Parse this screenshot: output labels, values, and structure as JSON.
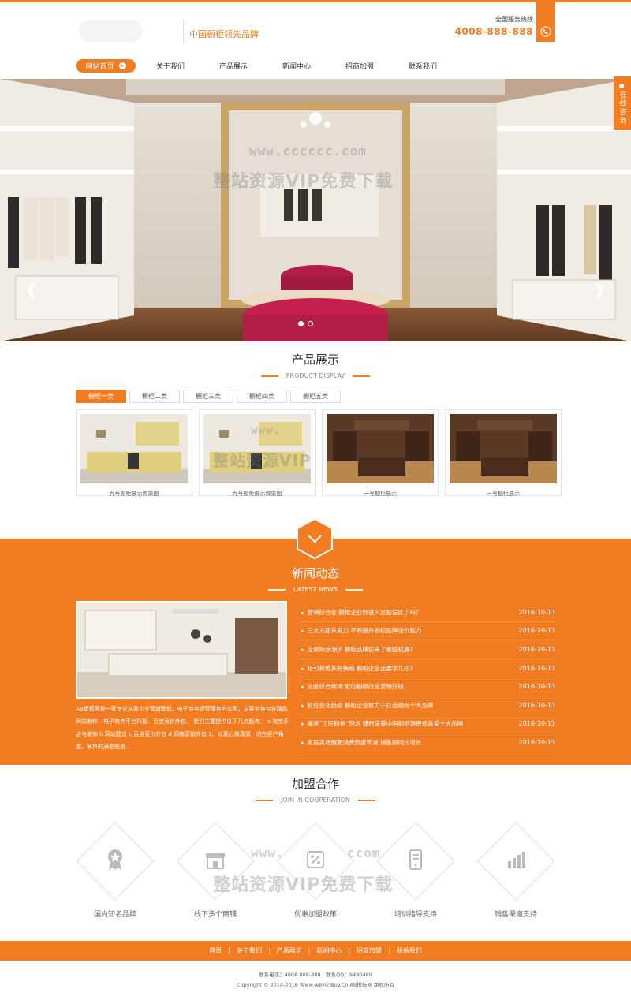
{
  "header": {
    "slogan": "中国橱柜领先品牌",
    "hotline_label": "全国服务热线",
    "hotline_number": "4008-888-888",
    "phone_icon": "phone-icon"
  },
  "nav": {
    "items": [
      {
        "label": "网站首页",
        "active": true
      },
      {
        "label": "关于我们"
      },
      {
        "label": "产品展示"
      },
      {
        "label": "新闻中心"
      },
      {
        "label": "招商加盟"
      },
      {
        "label": "联系我们"
      }
    ]
  },
  "banner": {
    "consult_label": "在线咨询",
    "prev_icon": "chevron-left-icon",
    "next_icon": "chevron-right-icon",
    "slides_total": 2,
    "slide_active": 1
  },
  "watermark": {
    "url": "www.cccccc.com",
    "text": "整站资源VIP免费下载",
    "url_partial": "www.",
    "text_partial": "整站资源VIP",
    "url_bottom": "www.",
    "url_bottom_end": "ccom"
  },
  "products": {
    "title": "产品展示",
    "subtitle": "PRODUCT DISPLAY",
    "tabs": [
      "橱柜一类",
      "橱柜二类",
      "橱柜三类",
      "橱柜四类",
      "橱柜五类"
    ],
    "items": [
      {
        "caption": "九号橱柜展示效果图",
        "style": "light"
      },
      {
        "caption": "九号橱柜展示效果图",
        "style": "light"
      },
      {
        "caption": "一号橱柜展示",
        "style": "dark"
      },
      {
        "caption": "一号橱柜展示",
        "style": "dark"
      }
    ]
  },
  "news": {
    "title": "新闻动态",
    "subtitle": "LATEST NEWS",
    "description": "AB模板网是一家专业从事企业营销策划、电子商务运营服务的公司，主要业务包含精品网站制作、电子商务平台托管、百度竞价外包、 我们主要提供以下几点服务： a 淘宝开店与装修 b 网站建设 c 百度竞价外包 d 网络营销外包 1、以真心换真情，站在客户角度，客户的满意就是...",
    "items": [
      {
        "title": "营销综合症 橱柜企业你进入这些误区了吗？",
        "date": "2016-10-13"
      },
      {
        "title": "三大方面来发力 不断提升橱柜品牌溢价能力",
        "date": "2016-10-13"
      },
      {
        "title": "互联网浪潮下 橱柜品牌迎来了哪些机遇?",
        "date": "2016-10-13"
      },
      {
        "title": "吸引和维系经销商 橱柜企业还要学几招?",
        "date": "2016-10-13"
      },
      {
        "title": "进驻综合商场 驱动橱柜行业营销升级",
        "date": "2016-10-13"
      },
      {
        "title": "抓住变化趋势 橱柜企业致力于打造橱柜十大品牌",
        "date": "2016-10-13"
      },
      {
        "title": "秉承“工匠精神”理念 捷西荣获中国橱柜消费者喜爱十大品牌",
        "date": "2016-10-13"
      },
      {
        "title": "家居卖场假期消费热度不减 销售额同比增长",
        "date": "2016-10-13"
      }
    ]
  },
  "cooperation": {
    "title": "加盟合作",
    "subtitle": "JOIN IN COOPERATION",
    "items": [
      {
        "label": "国内知名品牌",
        "icon": "award-icon"
      },
      {
        "label": "线下多个商铺",
        "icon": "store-icon"
      },
      {
        "label": "优惠加盟政策",
        "icon": "discount-icon"
      },
      {
        "label": "培训指导支持",
        "icon": "training-icon"
      },
      {
        "label": "销售渠道支持",
        "icon": "chart-icon"
      }
    ]
  },
  "footer": {
    "nav": [
      "首页",
      "关于我们",
      "产品展示",
      "新闻中心",
      "招商加盟",
      "联系我们"
    ],
    "separator": "|",
    "contact": "联系电话：4008-888-888　联系QQ：9490489",
    "copyright": "Copyright © 2014-2016 Www.AdminBuy.Cn AB模板网 版权所有"
  },
  "colors": {
    "accent": "#f27c22",
    "background": "#ffffff",
    "text": "#333333"
  }
}
